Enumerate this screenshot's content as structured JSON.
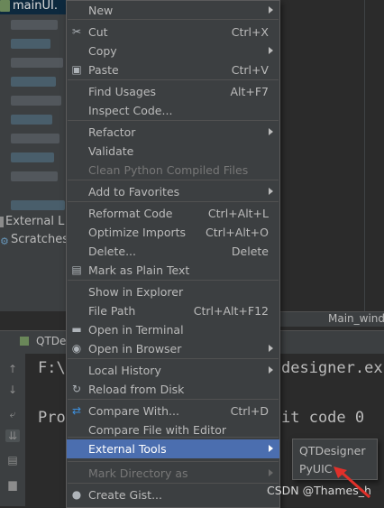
{
  "project_tree": {
    "selected_file": "mainUI.",
    "external_libraries": "External Libraries",
    "scratches": "Scratches a"
  },
  "editor": {
    "tab_label": "Main_wind"
  },
  "run_panel": {
    "tab_label": "QTDe",
    "line1": "F:\\",
    "line1_tail": "designer.ex",
    "line2": "Pro",
    "line2_tail": "it code 0"
  },
  "context_menu": {
    "items": [
      {
        "label": "New",
        "shortcut": "",
        "submenu": true,
        "icon": ""
      },
      {
        "label": "Cut",
        "shortcut": "Ctrl+X",
        "submenu": false,
        "icon": "scissors-icon"
      },
      {
        "label": "Copy",
        "shortcut": "",
        "submenu": true,
        "icon": ""
      },
      {
        "label": "Paste",
        "shortcut": "Ctrl+V",
        "submenu": false,
        "icon": "clipboard-icon"
      },
      {
        "label": "Find Usages",
        "shortcut": "Alt+F7",
        "submenu": false,
        "icon": ""
      },
      {
        "label": "Inspect Code...",
        "shortcut": "",
        "submenu": false,
        "icon": ""
      },
      {
        "label": "Refactor",
        "shortcut": "",
        "submenu": true,
        "icon": ""
      },
      {
        "label": "Validate",
        "shortcut": "",
        "submenu": false,
        "icon": ""
      },
      {
        "label": "Clean Python Compiled Files",
        "shortcut": "",
        "submenu": false,
        "icon": "",
        "disabled": true
      },
      {
        "label": "Add to Favorites",
        "shortcut": "",
        "submenu": true,
        "icon": ""
      },
      {
        "label": "Reformat Code",
        "shortcut": "Ctrl+Alt+L",
        "submenu": false,
        "icon": ""
      },
      {
        "label": "Optimize Imports",
        "shortcut": "Ctrl+Alt+O",
        "submenu": false,
        "icon": ""
      },
      {
        "label": "Delete...",
        "shortcut": "Delete",
        "submenu": false,
        "icon": ""
      },
      {
        "label": "Mark as Plain Text",
        "shortcut": "",
        "submenu": false,
        "icon": "plain-text-icon"
      },
      {
        "label": "Show in Explorer",
        "shortcut": "",
        "submenu": false,
        "icon": ""
      },
      {
        "label": "File Path",
        "shortcut": "Ctrl+Alt+F12",
        "submenu": false,
        "icon": ""
      },
      {
        "label": "Open in Terminal",
        "shortcut": "",
        "submenu": false,
        "icon": "terminal-icon"
      },
      {
        "label": "Open in Browser",
        "shortcut": "",
        "submenu": true,
        "icon": "globe-icon"
      },
      {
        "label": "Local History",
        "shortcut": "",
        "submenu": true,
        "icon": ""
      },
      {
        "label": "Reload from Disk",
        "shortcut": "",
        "submenu": false,
        "icon": "reload-icon"
      },
      {
        "label": "Compare With...",
        "shortcut": "Ctrl+D",
        "submenu": false,
        "icon": "compare-icon"
      },
      {
        "label": "Compare File with Editor",
        "shortcut": "",
        "submenu": false,
        "icon": ""
      },
      {
        "label": "External Tools",
        "shortcut": "",
        "submenu": true,
        "icon": "",
        "highlighted": true
      },
      {
        "label": "Mark Directory as",
        "shortcut": "",
        "submenu": true,
        "icon": "",
        "disabled": true
      },
      {
        "label": "Create Gist...",
        "shortcut": "",
        "submenu": false,
        "icon": "github-icon"
      }
    ]
  },
  "external_tools_submenu": {
    "items": [
      "QTDesigner",
      "PyUIC"
    ]
  },
  "watermark": "CSDN @Thames_h",
  "colors": {
    "menu_bg": "#3c3f41",
    "highlight": "#4b6eaf",
    "annotation_arrow": "#e0302a"
  }
}
